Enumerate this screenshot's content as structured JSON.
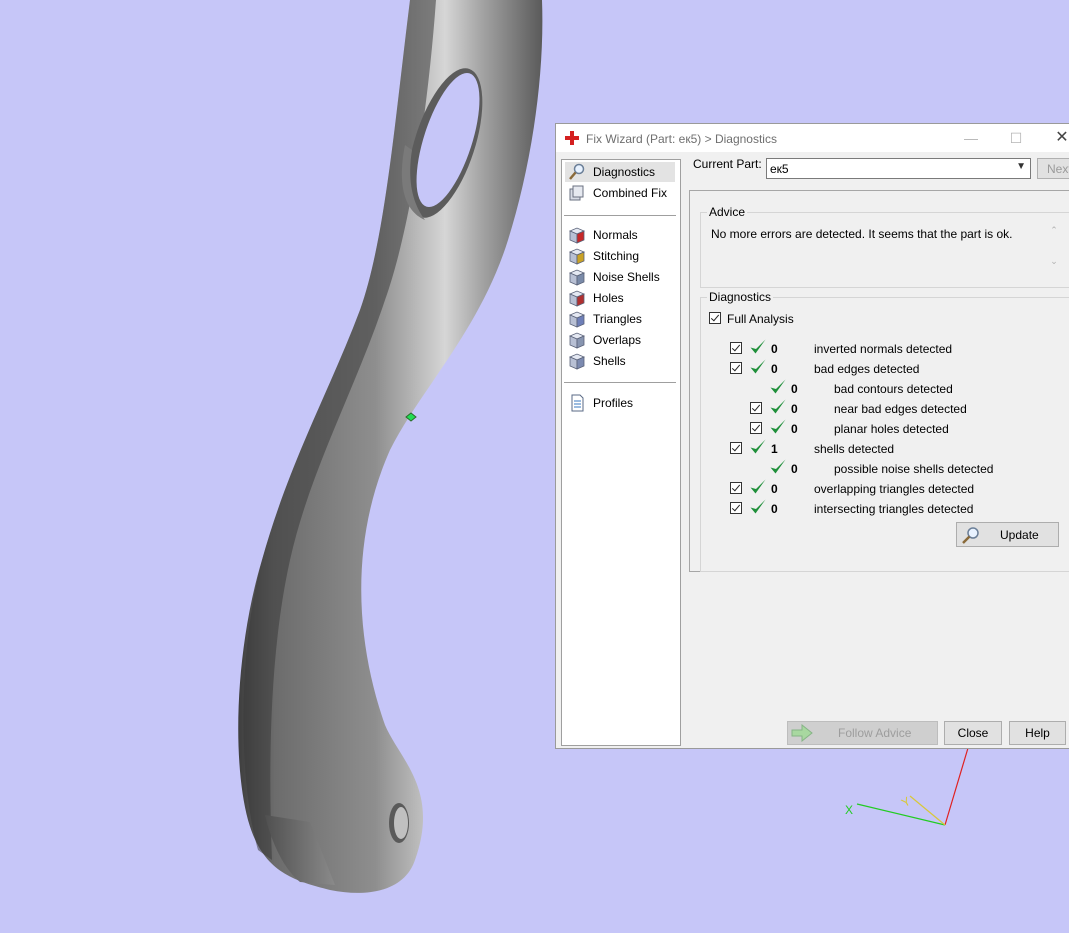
{
  "dialog": {
    "title": "Fix Wizard (Part: ек5) > Diagnostics",
    "current_part_label": "Current Part:",
    "current_part_value": "ек5",
    "next_label": "Next",
    "advice": {
      "title": "Advice",
      "text": "No more errors are detected. It seems that the part is ok."
    },
    "diagnostics": {
      "title": "Diagnostics",
      "full_analysis_label": "Full Analysis",
      "full_analysis_checked": true,
      "rows": [
        {
          "checkbox": true,
          "count": "0",
          "label": "inverted normals detected",
          "indent": 0
        },
        {
          "checkbox": true,
          "count": "0",
          "label": "bad edges detected",
          "indent": 0
        },
        {
          "checkbox": false,
          "count": "0",
          "label": "bad contours detected",
          "indent": 1
        },
        {
          "checkbox": true,
          "count": "0",
          "label": "near bad edges detected",
          "indent": 1
        },
        {
          "checkbox": true,
          "count": "0",
          "label": "planar holes detected",
          "indent": 1
        },
        {
          "checkbox": true,
          "count": "1",
          "label": "shells detected",
          "indent": 0
        },
        {
          "checkbox": false,
          "count": "0",
          "label": "possible noise shells detected",
          "indent": 1
        },
        {
          "checkbox": true,
          "count": "0",
          "label": "overlapping triangles detected",
          "indent": 0
        },
        {
          "checkbox": true,
          "count": "0",
          "label": "intersecting triangles detected",
          "indent": 0
        }
      ],
      "update_label": "Update"
    },
    "buttons": {
      "follow_advice": "Follow Advice",
      "close": "Close",
      "help": "Help"
    }
  },
  "sidebar": {
    "groups": [
      [
        {
          "label": "Diagnostics",
          "icon": "magnifier-icon",
          "selected": true
        },
        {
          "label": "Combined Fix",
          "icon": "combined-fix-icon",
          "selected": false
        }
      ],
      [
        {
          "label": "Normals",
          "icon": "normals-cube-icon",
          "selected": false
        },
        {
          "label": "Stitching",
          "icon": "stitching-cube-icon",
          "selected": false
        },
        {
          "label": "Noise Shells",
          "icon": "noise-shells-cube-icon",
          "selected": false
        },
        {
          "label": "Holes",
          "icon": "holes-cube-icon",
          "selected": false
        },
        {
          "label": "Triangles",
          "icon": "triangles-cube-icon",
          "selected": false
        },
        {
          "label": "Overlaps",
          "icon": "overlaps-cube-icon",
          "selected": false
        },
        {
          "label": "Shells",
          "icon": "shells-cube-icon",
          "selected": false
        }
      ],
      [
        {
          "label": "Profiles",
          "icon": "document-icon",
          "selected": false
        }
      ]
    ]
  },
  "axes": {
    "x": "X",
    "y": "Y",
    "x_color": "#22cc22",
    "y_color": "#d8c838",
    "z_color": "#e02020"
  },
  "colors": {
    "viewport_background": "#c6c6f8",
    "check_green": "#1f8f3a"
  }
}
